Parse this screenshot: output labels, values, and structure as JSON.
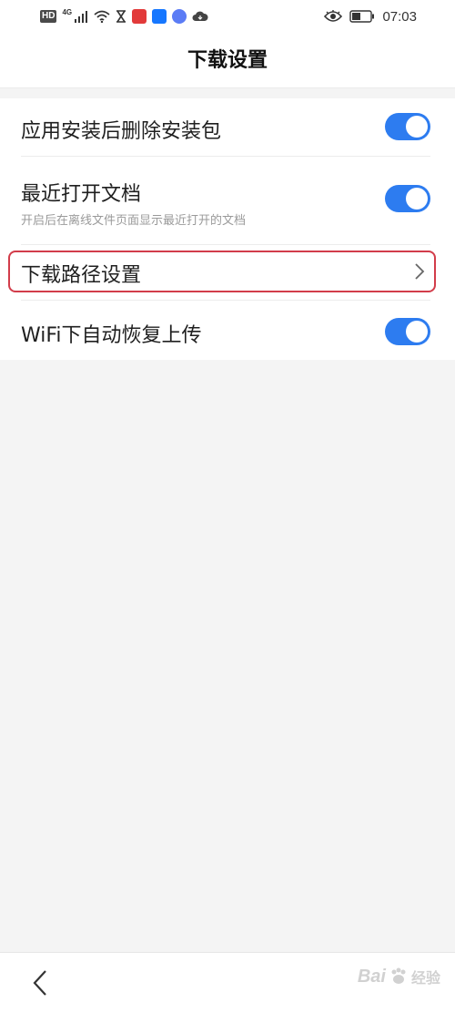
{
  "status_bar": {
    "hd_label": "HD",
    "network_label": "4G",
    "time": "07:03",
    "icons": [
      "signal-icon",
      "wifi-icon",
      "hourglass-icon",
      "app-red-icon",
      "app-alipay-icon",
      "app-music-icon",
      "cloud-icon",
      "eye-icon",
      "battery-icon"
    ]
  },
  "header": {
    "title": "下载设置"
  },
  "settings": {
    "items": [
      {
        "label": "应用安装后删除安装包",
        "type": "toggle",
        "enabled": true
      },
      {
        "label": "最近打开文档",
        "sublabel": "开启后在离线文件页面显示最近打开的文档",
        "type": "toggle",
        "enabled": true
      },
      {
        "label": "下载路径设置",
        "type": "link"
      },
      {
        "label": "WiFi下自动恢复上传",
        "type": "toggle",
        "enabled": true
      }
    ]
  },
  "navigation": {
    "back_icon": "chevron-left-icon"
  },
  "watermark": {
    "text": "Bai",
    "suffix": "经验"
  },
  "colors": {
    "accent": "#2d7cf0",
    "highlight": "#d23c4a",
    "background": "#f4f4f4"
  }
}
